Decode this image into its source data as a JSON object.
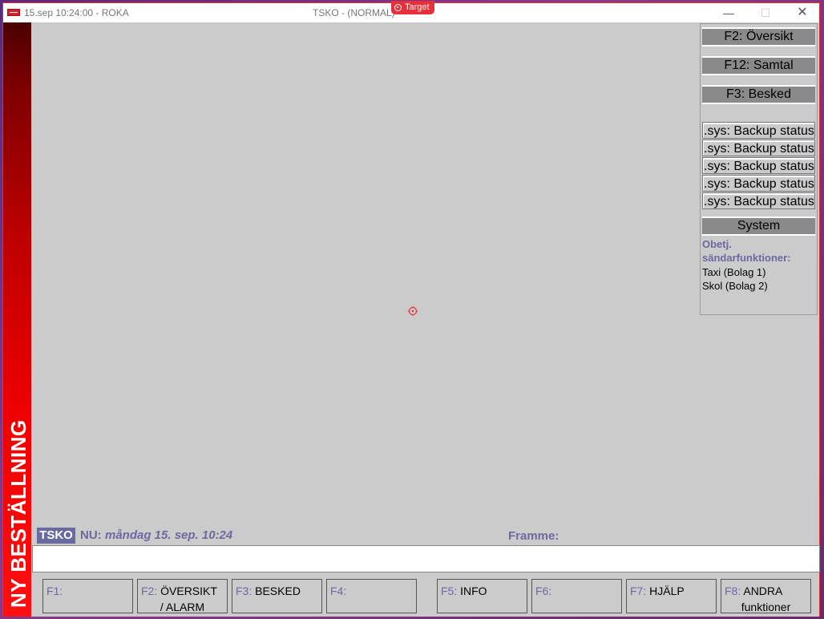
{
  "titlebar": {
    "left_title": "15.sep 10:24:00 - ROKA",
    "center_title": "TSKO - (NORMAL)",
    "target_badge": "Target",
    "minimize": "—",
    "maximize": "☐",
    "close": "✕"
  },
  "sidebar": {
    "label": "NY BESTÄLLNING"
  },
  "rightpanel": {
    "buttons": [
      "F2: Översikt",
      "F12: Samtal",
      "F3: Besked"
    ],
    "sys_items": [
      ".sys: Backup status",
      ".sys: Backup status",
      ".sys: Backup status",
      ".sys: Backup status",
      ".sys: Backup status"
    ],
    "system_header": "System",
    "section_label_1": "Obetj.",
    "section_label_2": "sändarfunktioner:",
    "items": [
      "Taxi (Bolag 1)",
      "Skol (Bolag 2)"
    ]
  },
  "status": {
    "tsko": "TSKO",
    "nu_label": "NU:",
    "nu_date": "måndag 15. sep. 10:24",
    "framme": "Framme:"
  },
  "fkeys": [
    {
      "code": "F1:",
      "line1": "",
      "line2": ""
    },
    {
      "code": "F2:",
      "line1": " ÖVERSIKT",
      "line2": "/ ALARM"
    },
    {
      "code": "F3:",
      "line1": " BESKED",
      "line2": ""
    },
    {
      "code": "F4:",
      "line1": "",
      "line2": ""
    },
    {
      "code": "F5:",
      "line1": " INFO",
      "line2": ""
    },
    {
      "code": "F6:",
      "line1": "",
      "line2": ""
    },
    {
      "code": "F7:",
      "line1": " HJÄLP",
      "line2": ""
    },
    {
      "code": "F8:",
      "line1": " ANDRA",
      "line2": "funktioner"
    }
  ],
  "colors": {
    "accent": "#6a6aa0",
    "sidebar_red": "#ee0000",
    "background": "#cbcbcb"
  }
}
